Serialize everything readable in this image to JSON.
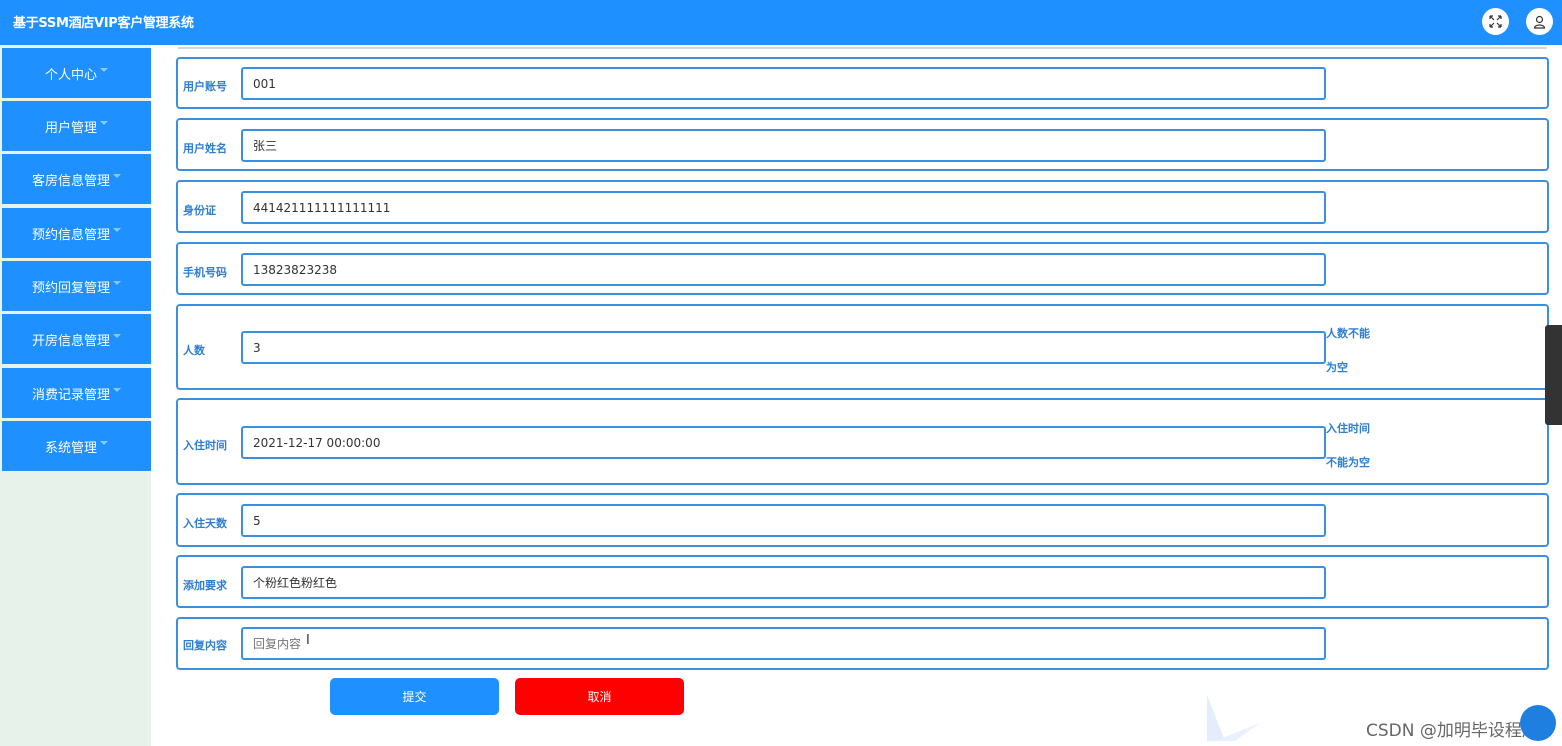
{
  "header": {
    "title": "基于SSM酒店VIP客户管理系统",
    "fullscreen_icon": "fullscreen-icon",
    "user_icon": "user-icon"
  },
  "sidebar": {
    "items": [
      {
        "label": "个人中心"
      },
      {
        "label": "用户管理"
      },
      {
        "label": "客房信息管理"
      },
      {
        "label": "预约信息管理"
      },
      {
        "label": "预约回复管理"
      },
      {
        "label": "开房信息管理"
      },
      {
        "label": "消费记录管理"
      },
      {
        "label": "系统管理"
      }
    ]
  },
  "form": {
    "fields": [
      {
        "label": "用户账号",
        "value": "001"
      },
      {
        "label": "用户姓名",
        "value": "张三"
      },
      {
        "label": "身份证",
        "value": "441421111111111111"
      },
      {
        "label": "手机号码",
        "value": "13823823238"
      },
      {
        "label": "人数",
        "value": "3",
        "hint_line1": "人数不能",
        "hint_line2": "为空"
      },
      {
        "label": "入住时间",
        "value": "2021-12-17 00:00:00",
        "hint_line1": "入住时间",
        "hint_line2": "不能为空"
      },
      {
        "label": "入住天数",
        "value": "5"
      },
      {
        "label": "添加要求",
        "value": "个粉红色粉红色"
      },
      {
        "label": "回复内容",
        "value": "",
        "placeholder": "回复内容"
      }
    ],
    "submit_label": "提交",
    "cancel_label": "取消"
  },
  "watermark": "CSDN @加明毕设程序",
  "colors": {
    "primary": "#1e90ff",
    "danger": "#ff0000",
    "sidebar_bg": "#e7f2ea",
    "label": "#2f7fd0"
  }
}
